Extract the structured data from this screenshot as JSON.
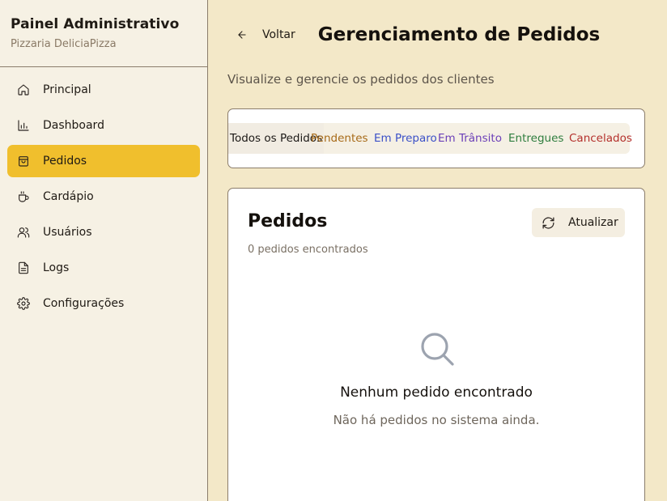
{
  "sidebar": {
    "title": "Painel Administrativo",
    "subtitle": "Pizzaria DeliciaPizza",
    "items": [
      {
        "label": "Principal",
        "icon": "home-icon"
      },
      {
        "label": "Dashboard",
        "icon": "bar-chart-icon"
      },
      {
        "label": "Pedidos",
        "icon": "shopping-bag-icon",
        "active": true
      },
      {
        "label": "Cardápio",
        "icon": "coffee-cup-icon"
      },
      {
        "label": "Usuários",
        "icon": "users-icon"
      },
      {
        "label": "Logs",
        "icon": "file-text-icon"
      },
      {
        "label": "Configurações",
        "icon": "gear-icon"
      }
    ]
  },
  "header": {
    "back_label": "Voltar",
    "title": "Gerenciamento de Pedidos",
    "description": "Visualize e gerencie os pedidos dos clientes"
  },
  "tabs": [
    {
      "label": "Todos os Pedidos",
      "selected": true
    },
    {
      "label": "Pendentes",
      "color": "#a76a18"
    },
    {
      "label": "Em Preparo",
      "color": "#3b50c8"
    },
    {
      "label": "Em Trânsito",
      "color": "#6b3fb8"
    },
    {
      "label": "Entregues",
      "color": "#2e7d3e"
    },
    {
      "label": "Cancelados",
      "color": "#b4302c"
    }
  ],
  "orders": {
    "title": "Pedidos",
    "count_text": "0 pedidos encontrados",
    "refresh_label": "Atualizar",
    "empty_title": "Nenhum pedido encontrado",
    "empty_description": "Não há pedidos no sistema ainda."
  },
  "colors": {
    "accent": "#f0bf2d",
    "background": "#f3e8c8",
    "sidebar": "#f6f1e4"
  }
}
